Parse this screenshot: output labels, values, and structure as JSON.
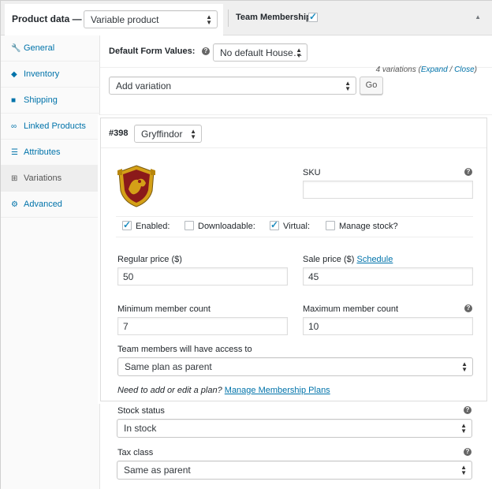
{
  "header": {
    "product_data_label": "Product data —",
    "product_type": "Variable product",
    "team_membership_label": "Team Membership:",
    "team_membership_checked": true,
    "collapse_icon": "triangle-up-icon"
  },
  "sidebar": {
    "items": [
      {
        "label": "General",
        "icon": "wrench-icon",
        "active": false
      },
      {
        "label": "Inventory",
        "icon": "tag-icon",
        "active": false
      },
      {
        "label": "Shipping",
        "icon": "truck-icon",
        "active": false
      },
      {
        "label": "Linked Products",
        "icon": "link-icon",
        "active": false
      },
      {
        "label": "Attributes",
        "icon": "list-icon",
        "active": false
      },
      {
        "label": "Variations",
        "icon": "grid-icon",
        "active": true
      },
      {
        "label": "Advanced",
        "icon": "gear-icon",
        "active": false
      }
    ]
  },
  "defaults": {
    "label": "Default Form Values:",
    "value": "No default House…"
  },
  "add_variation": {
    "value": "Add variation",
    "go_label": "Go"
  },
  "variations_count": {
    "text": "4 variations (",
    "expand": "Expand",
    "slash": " / ",
    "close": "Close",
    "end": ")"
  },
  "variation": {
    "id": "#398",
    "house": "Gryffindor",
    "sku_label": "SKU",
    "sku_value": "",
    "enabled_label": "Enabled:",
    "enabled": true,
    "downloadable_label": "Downloadable:",
    "downloadable": false,
    "virtual_label": "Virtual:",
    "virtual": true,
    "manage_stock_label": "Manage stock?",
    "manage_stock": false,
    "regular_price_label": "Regular price ($)",
    "regular_price": "50",
    "sale_price_label": "Sale price ($)",
    "schedule_link": "Schedule",
    "sale_price": "45",
    "min_member_label": "Minimum member count",
    "min_member": "7",
    "max_member_label": "Maximum member count",
    "max_member": "10",
    "access_label": "Team members will have access to",
    "access_value": "Same plan as parent",
    "plan_note": "Need to add or edit a plan?",
    "plan_link": "Manage Membership Plans"
  },
  "lower": {
    "stock_status_label": "Stock status",
    "stock_status": "In stock",
    "tax_class_label": "Tax class",
    "tax_class": "Same as parent"
  },
  "colors": {
    "link": "#0073aa",
    "checkbox": "#1e8cbe",
    "crest_red": "#8b1a1a",
    "crest_gold": "#d4a017"
  }
}
